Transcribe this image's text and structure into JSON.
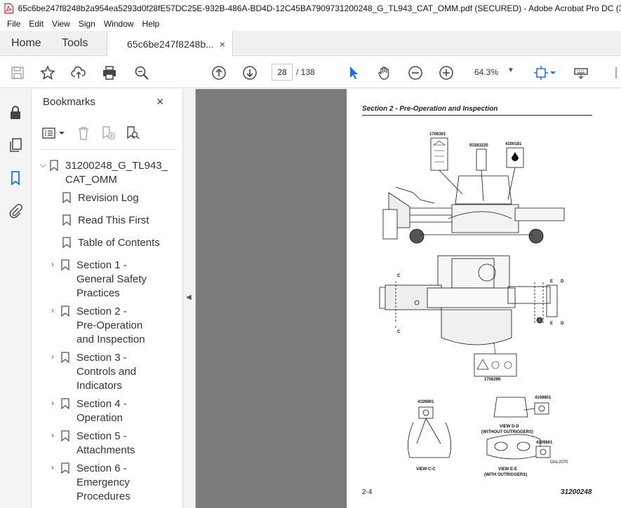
{
  "window": {
    "title": "65c6be247f8248b2a954ea5293d0f28fE57DC25E-932B-486A-BD4D-12C45BA7909731200248_G_TL943_CAT_OMM.pdf (SECURED) - Adobe Acrobat Pro DC (32-bit)"
  },
  "menu": {
    "items": [
      "File",
      "Edit",
      "View",
      "Sign",
      "Window",
      "Help"
    ]
  },
  "tabs": {
    "home": "Home",
    "tools": "Tools",
    "doc": "65c6be247f8248b...",
    "close": "×"
  },
  "toolbar": {
    "page_current": "28",
    "page_total": "/ 138",
    "zoom": "64.3%"
  },
  "bookmarks": {
    "title": "Bookmarks",
    "close": "×",
    "items": [
      {
        "label": "31200248_G_TL943_\nCAT_OMM",
        "expanded": true
      },
      {
        "label": "Revision Log"
      },
      {
        "label": "Read This First"
      },
      {
        "label": "Table of Contents"
      },
      {
        "label": "Section 1 -\nGeneral Safety\nPractices"
      },
      {
        "label": "Section 2 -\nPre-Operation\nand Inspection"
      },
      {
        "label": "Section 3 -\nControls and\nIndicators"
      },
      {
        "label": "Section 4 -\nOperation"
      },
      {
        "label": "Section 5 -\nAttachments"
      },
      {
        "label": "Section 6 -\nEmergency\nProcedures"
      }
    ]
  },
  "document": {
    "header": "Section 2 - Pre-Operation and Inspection",
    "footer_left": "2-4",
    "footer_right": "31200248",
    "labels": {
      "l1": "1706301",
      "l2": "91583220",
      "l3": "4100181",
      "l4": "1706296",
      "l5": "4109801",
      "l6": "4109801",
      "l7": "4109801",
      "view_cc": "VIEW C-C",
      "view_dd": "VIEW D-D",
      "without": "(WITHOUT OUTRIGGERS)",
      "view_ee": "VIEW E-E",
      "with": "(WITH OUTRIGGERS)",
      "ref": "OAL2070",
      "c": "C",
      "d": "D",
      "e": "E"
    }
  }
}
